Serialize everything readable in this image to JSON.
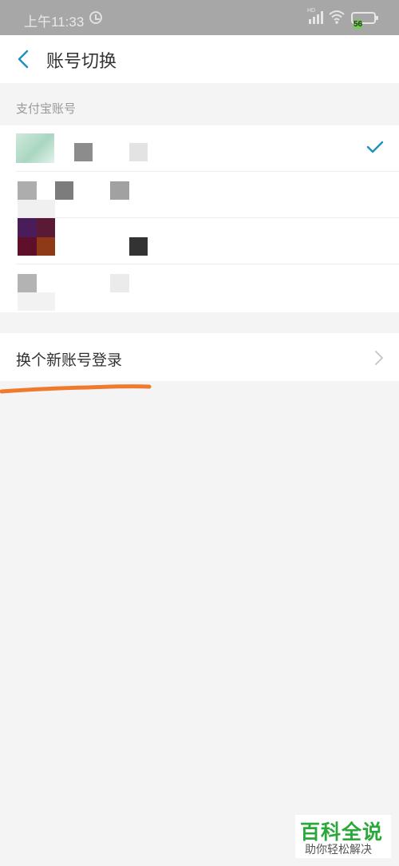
{
  "status_bar": {
    "time": "上午11:33",
    "network_label": "HD",
    "battery": "56"
  },
  "header": {
    "title": "账号切换"
  },
  "section": {
    "label": "支付宝账号"
  },
  "accounts": [
    {
      "selected": true
    },
    {
      "selected": false
    },
    {
      "selected": false
    },
    {
      "selected": false
    }
  ],
  "actions": {
    "new_login_label": "换个新账号登录"
  },
  "watermark": {
    "title": "百科全说",
    "subtitle": "助你轻松解决"
  },
  "colors": {
    "accent": "#1e8fbf",
    "annotation": "#f07a2c",
    "watermark_green": "#2aa83a",
    "battery": "#6fd14c"
  }
}
